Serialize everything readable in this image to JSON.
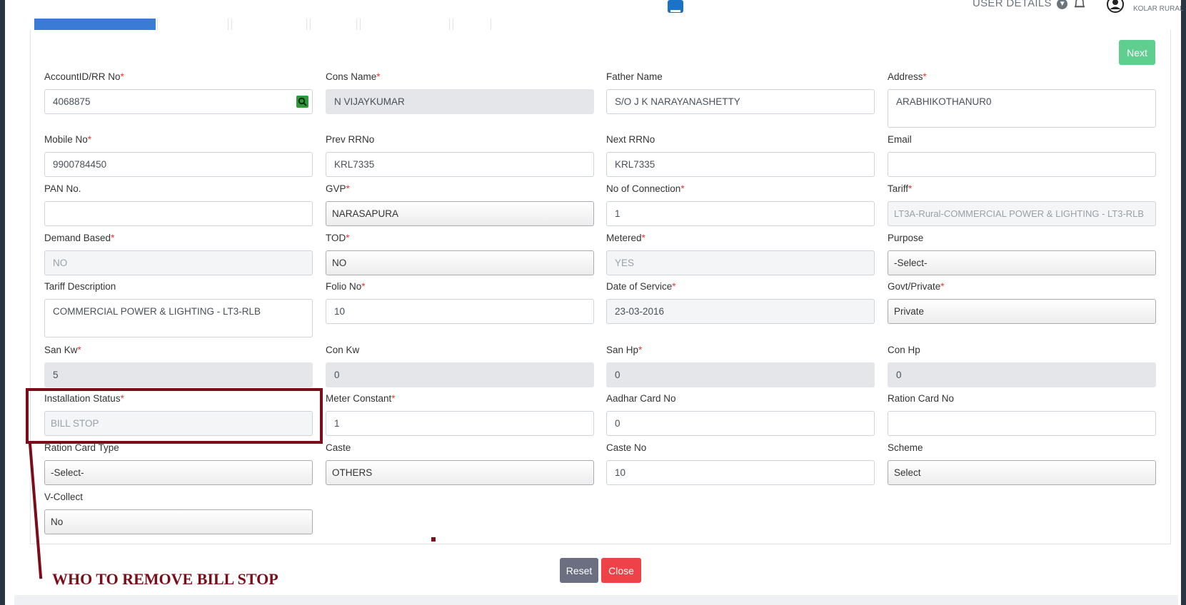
{
  "header": {
    "user_details_label": "USER DETAILS",
    "user_region": "KOLAR RURAL"
  },
  "tabs": [
    {
      "label": ""
    },
    {
      "label": ""
    },
    {
      "label": ""
    },
    {
      "label": ""
    },
    {
      "label": ""
    },
    {
      "label": ""
    }
  ],
  "toolbar": {
    "next_label": "Next",
    "reset_label": "Reset",
    "close_label": "Close"
  },
  "form": {
    "account_id": {
      "label": "AccountID/RR No",
      "required": "*",
      "value": "4068875"
    },
    "cons_name": {
      "label": "Cons Name",
      "required": "*",
      "value": "N VIJAYKUMAR"
    },
    "father_name": {
      "label": "Father Name",
      "value": "S/O J K NARAYANASHETTY"
    },
    "address": {
      "label": "Address",
      "required": "*",
      "value": "ARABHIKOTHANUR0"
    },
    "mobile_no": {
      "label": "Mobile No",
      "required": "*",
      "value": "9900784450"
    },
    "prev_rrno": {
      "label": "Prev RRNo",
      "value": "KRL7335"
    },
    "next_rrno": {
      "label": "Next RRNo",
      "value": "KRL7335"
    },
    "email": {
      "label": "Email",
      "value": ""
    },
    "pan_no": {
      "label": "PAN No.",
      "value": ""
    },
    "gvp": {
      "label": "GVP",
      "required": "*",
      "value": "NARASAPURA"
    },
    "no_of_connection": {
      "label": "No of Connection",
      "required": "*",
      "value": "1"
    },
    "tariff": {
      "label": "Tariff",
      "required": "*",
      "value": "LT3A-Rural-COMMERCIAL POWER & LIGHTING - LT3-RLB"
    },
    "demand_based": {
      "label": "Demand Based",
      "required": "*",
      "value": "NO"
    },
    "tod": {
      "label": "TOD",
      "required": "*",
      "value": "NO"
    },
    "metered": {
      "label": "Metered",
      "required": "*",
      "value": "YES"
    },
    "purpose": {
      "label": "Purpose",
      "value": "-Select-"
    },
    "tariff_description": {
      "label": "Tariff Description",
      "value": "COMMERCIAL POWER & LIGHTING - LT3-RLB"
    },
    "folio_no": {
      "label": "Folio No",
      "required": "*",
      "value": "10"
    },
    "date_of_service": {
      "label": "Date of Service",
      "required": "*",
      "value": "23-03-2016"
    },
    "govt_private": {
      "label": "Govt/Private",
      "required": "*",
      "value": "Private"
    },
    "san_kw": {
      "label": "San Kw",
      "required": "*",
      "value": "5"
    },
    "con_kw": {
      "label": "Con Kw",
      "value": "0"
    },
    "san_hp": {
      "label": "San Hp",
      "required": "*",
      "value": "0"
    },
    "con_hp": {
      "label": "Con Hp",
      "value": "0"
    },
    "installation_status": {
      "label": "Installation Status",
      "required": "*",
      "value": "BILL STOP"
    },
    "meter_constant": {
      "label": "Meter Constant",
      "required": "*",
      "value": "1"
    },
    "aadhar_card_no": {
      "label": "Aadhar Card No",
      "value": "0"
    },
    "ration_card_no": {
      "label": "Ration Card No",
      "value": ""
    },
    "ration_card_type": {
      "label": "Ration Card Type",
      "value": "-Select-"
    },
    "caste": {
      "label": "Caste",
      "value": "OTHERS"
    },
    "caste_no": {
      "label": "Caste No",
      "value": "10"
    },
    "scheme": {
      "label": "Scheme",
      "value": "Select"
    },
    "v_collect": {
      "label": "V-Collect",
      "value": "No"
    }
  },
  "annotation": {
    "text": "WHO TO REMOVE BILL STOP"
  },
  "colors": {
    "annotation": "#7b0c19",
    "next_button": "#5ecf8f",
    "reset_button": "#6c6f82",
    "close_button": "#ee4248",
    "required_marker": "#e53935"
  }
}
